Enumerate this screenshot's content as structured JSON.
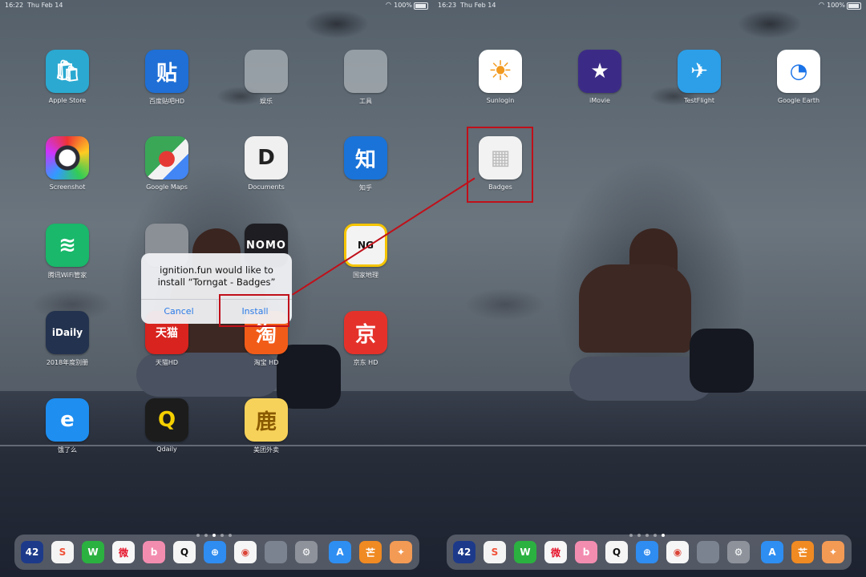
{
  "left": {
    "status": {
      "time": "16:22",
      "date": "Thu Feb 14",
      "battery": "100%"
    },
    "apps": [
      {
        "label": "Apple Store",
        "glyph": "",
        "color": "#2ba9d1"
      },
      {
        "label": "百度贴吧HD",
        "glyph": "贴",
        "color": "#1f6fd6"
      },
      {
        "label": "娱乐",
        "glyph": "",
        "color": "folder"
      },
      {
        "label": "工具",
        "glyph": "",
        "color": "folder"
      },
      {
        "label": "Screenshot",
        "glyph": "◎",
        "color": "#2b2b36"
      },
      {
        "label": "Google Maps",
        "glyph": "G",
        "color": "#3aa757"
      },
      {
        "label": "Documents",
        "glyph": "D",
        "color": "#e8e8e8"
      },
      {
        "label": "知乎",
        "glyph": "知",
        "color": "#1a73d8"
      },
      {
        "label": "腾讯WiFi管家",
        "glyph": "≋",
        "color": "#19b86a"
      },
      {
        "label": "",
        "glyph": "",
        "color": "#8b8f96"
      },
      {
        "label": "",
        "glyph": "NOMO",
        "color": "#1d1d22"
      },
      {
        "label": "国家地理",
        "glyph": "NG",
        "color": "#f3f3f3"
      },
      {
        "label": "2018年度别册",
        "glyph": "iDaily",
        "color": "#23324e"
      },
      {
        "label": "天猫HD",
        "glyph": "天猫",
        "color": "#d8231e"
      },
      {
        "label": "淘宝 HD",
        "glyph": "淘",
        "color": "#f25c19"
      },
      {
        "label": "京东 HD",
        "glyph": "京",
        "color": "#e4322b"
      },
      {
        "label": "饿了么",
        "glyph": "e",
        "color": "#1e8ef0"
      },
      {
        "label": "Qdaily",
        "glyph": "Q",
        "color": "#1c1c1c"
      },
      {
        "label": "美团外卖",
        "glyph": "鹿",
        "color": "#f7d25a"
      }
    ],
    "alert": {
      "line1": "ignition.fun would like to",
      "line2": "install “Torngat - Badges”",
      "cancel": "Cancel",
      "install": "Install"
    }
  },
  "right": {
    "status": {
      "time": "16:23",
      "date": "Thu Feb 14",
      "battery": "100%"
    },
    "apps": [
      {
        "label": "Sunlogin",
        "glyph": "☀",
        "color": "#f29a1f"
      },
      {
        "label": "iMovie",
        "glyph": "★",
        "color": "#3c2b86"
      },
      {
        "label": "TestFlight",
        "glyph": "✈",
        "color": "#2c9fe8"
      },
      {
        "label": "Google Earth",
        "glyph": "◔",
        "color": "#ffffff"
      },
      {
        "label": "Badges",
        "glyph": "▦",
        "color": "#f2f2f2"
      }
    ]
  },
  "dock": [
    {
      "name": "dock-42",
      "glyph": "42",
      "color": "#1d3a8a"
    },
    {
      "name": "dock-swift",
      "glyph": "S",
      "color": "#f4f4f4"
    },
    {
      "name": "dock-wechat",
      "glyph": "W",
      "color": "#2bb140"
    },
    {
      "name": "dock-weibo",
      "glyph": "微",
      "color": "#f7f7f7"
    },
    {
      "name": "dock-bilibili",
      "glyph": "b",
      "color": "#f38db0"
    },
    {
      "name": "dock-qq",
      "glyph": "Q",
      "color": "#f5f5f5"
    },
    {
      "name": "dock-safari",
      "glyph": "⊕",
      "color": "#2f8cf0"
    },
    {
      "name": "dock-chrome",
      "glyph": "◉",
      "color": "#f6f6f6"
    },
    {
      "name": "dock-folder",
      "glyph": "",
      "color": "#7b8390"
    },
    {
      "name": "dock-settings",
      "glyph": "⚙",
      "color": "#8e939b"
    },
    {
      "name": "dock-appstore",
      "glyph": "A",
      "color": "#2e8ef2"
    },
    {
      "name": "dock-mango",
      "glyph": "芒",
      "color": "#f08a22"
    },
    {
      "name": "dock-other",
      "glyph": "✦",
      "color": "#f39a55"
    }
  ]
}
